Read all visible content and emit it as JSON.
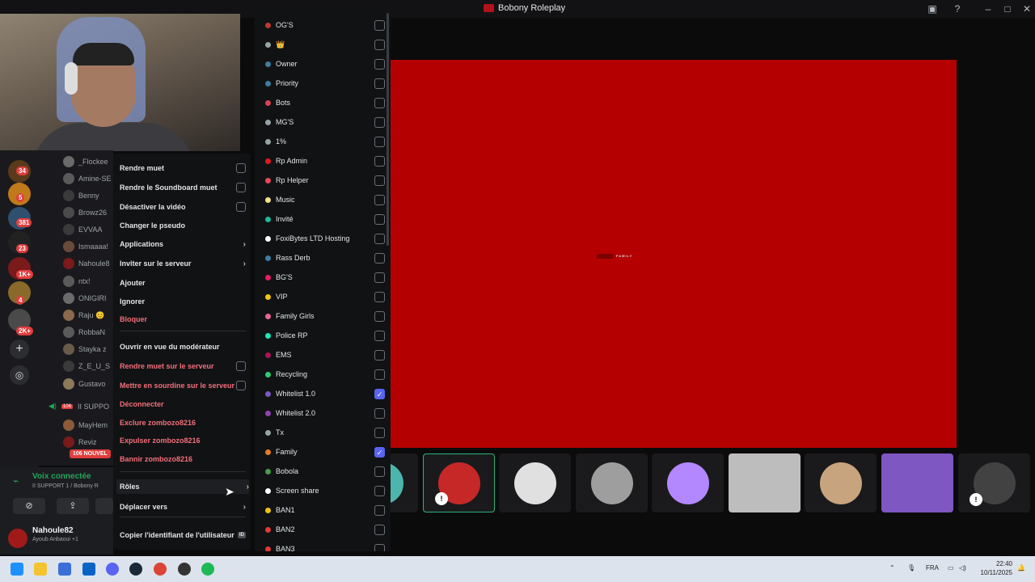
{
  "window": {
    "title": "Bobony Roleplay"
  },
  "server_rail": {
    "badges": [
      "34",
      "5",
      "381",
      "23",
      "1K+",
      "4",
      "2K+"
    ],
    "add_server": "+",
    "explore": "◎"
  },
  "members": [
    {
      "name": "_Flockee"
    },
    {
      "name": "Amine-SE"
    },
    {
      "name": "Benny"
    },
    {
      "name": "Browz26"
    },
    {
      "name": "EVVAA"
    },
    {
      "name": "Ismaaaa!"
    },
    {
      "name": "Nahoule8"
    },
    {
      "name": "ntx!"
    },
    {
      "name": "ONIGIRI"
    },
    {
      "name": "Raju 😊"
    },
    {
      "name": "RobbaN"
    },
    {
      "name": "Stayka z"
    },
    {
      "name": "Z_E_U_S"
    },
    {
      "name": "Gustavo"
    }
  ],
  "voice_channel": {
    "label": "II SUPPO",
    "members": [
      {
        "name": "MayHem"
      },
      {
        "name": "Reviz"
      }
    ],
    "new_badge": "106 NOUVEL"
  },
  "voice_panel": {
    "status": "Voix connectée",
    "channel": "II SUPPORT 1 / Bobony R",
    "user": "Nahoule82",
    "sub": "Ayoub Anbaoui +1"
  },
  "context_menu": {
    "items": [
      {
        "label": "Rendre muet",
        "type": "check"
      },
      {
        "label": "Rendre le Soundboard muet",
        "type": "check"
      },
      {
        "label": "Désactiver la vidéo",
        "type": "check"
      },
      {
        "label": "Changer le pseudo",
        "type": "plain"
      },
      {
        "label": "Applications",
        "type": "sub"
      },
      {
        "label": "Inviter sur le serveur",
        "type": "sub"
      },
      {
        "label": "Ajouter",
        "type": "plain"
      },
      {
        "label": "Ignorer",
        "type": "plain"
      },
      {
        "label": "Bloquer",
        "type": "danger"
      },
      {
        "label": "Ouvrir en vue du modérateur",
        "type": "plain"
      },
      {
        "label": "Rendre muet sur le serveur",
        "type": "danger-check"
      },
      {
        "label": "Mettre en sourdine sur le serveur",
        "type": "danger-check"
      },
      {
        "label": "Déconnecter",
        "type": "danger"
      },
      {
        "label": "Exclure zombozo8216",
        "type": "danger"
      },
      {
        "label": "Expulser zombozo8216",
        "type": "danger"
      },
      {
        "label": "Bannir zombozo8216",
        "type": "danger"
      },
      {
        "label": "Rôles",
        "type": "sub"
      },
      {
        "label": "Déplacer vers",
        "type": "sub"
      },
      {
        "label": "Copier l'identifiant de l'utilisateur",
        "type": "id",
        "badge": "ID"
      }
    ]
  },
  "roles": [
    {
      "name": "OG'S",
      "color": "#c0392b",
      "checked": false
    },
    {
      "name": "👑",
      "color": "#95a5a6",
      "checked": false
    },
    {
      "name": "Owner",
      "color": "#3b7ea1",
      "checked": false
    },
    {
      "name": "Priority",
      "color": "#3b7ea1",
      "checked": false
    },
    {
      "name": "Bots",
      "color": "#d94352",
      "checked": false
    },
    {
      "name": "MG'S",
      "color": "#95a5a6",
      "checked": false
    },
    {
      "name": "1%",
      "color": "#95a5a6",
      "checked": false
    },
    {
      "name": "Rp Admin",
      "color": "#e31b1b",
      "checked": false
    },
    {
      "name": "Rp Helper",
      "color": "#e8495b",
      "checked": false
    },
    {
      "name": "Music",
      "color": "#f7e08a",
      "checked": false
    },
    {
      "name": "Invité",
      "color": "#1abc9c",
      "checked": false
    },
    {
      "name": "FoxiBytes LTD Hosting",
      "color": "#ffffff",
      "checked": false
    },
    {
      "name": "Rass Derb",
      "color": "#3b7ea1",
      "checked": false
    },
    {
      "name": "BG'S",
      "color": "#e91e63",
      "checked": false
    },
    {
      "name": "VIP",
      "color": "#f1c40f",
      "checked": false
    },
    {
      "name": "Family Girls",
      "color": "#f06292",
      "checked": false
    },
    {
      "name": "Police RP",
      "color": "#1de9b6",
      "checked": false
    },
    {
      "name": "EMS",
      "color": "#ad1457",
      "checked": false
    },
    {
      "name": "Recycling",
      "color": "#2ecc71",
      "checked": false
    },
    {
      "name": "Whitelist 1.0",
      "color": "#7e57c2",
      "checked": true
    },
    {
      "name": "Whitelist 2.0",
      "color": "#8e44ad",
      "checked": false
    },
    {
      "name": "Tx",
      "color": "#95a5a6",
      "checked": false
    },
    {
      "name": "Family",
      "color": "#e67e22",
      "checked": true
    },
    {
      "name": "Bobola",
      "color": "#43a047",
      "checked": false
    },
    {
      "name": "Screen share",
      "color": "#ffffff",
      "checked": false
    },
    {
      "name": "BAN1",
      "color": "#f1c40f",
      "checked": false
    },
    {
      "name": "BAN2",
      "color": "#e53935",
      "checked": false
    },
    {
      "name": "BAN3",
      "color": "#e53935",
      "checked": false
    }
  ],
  "stream": {
    "logo_text": "FAMILY"
  },
  "tiles": [
    {
      "name": "tile-1",
      "color": "#4db6ac"
    },
    {
      "name": "tile-2",
      "color": "#c62828"
    },
    {
      "name": "tile-3",
      "color": "#e0e0e0"
    },
    {
      "name": "tile-4",
      "color": "#9e9e9e"
    },
    {
      "name": "tile-5",
      "color": "#b388ff"
    },
    {
      "name": "tile-6",
      "color": "#bdbdbd"
    },
    {
      "name": "tile-7",
      "color": "#c8a47e"
    },
    {
      "name": "tile-8",
      "color": "#7e57c2"
    },
    {
      "name": "tile-9",
      "color": "#424242"
    }
  ],
  "taskbar": {
    "lang": "FRA",
    "time": "22:40",
    "date": "10/11/2025"
  }
}
